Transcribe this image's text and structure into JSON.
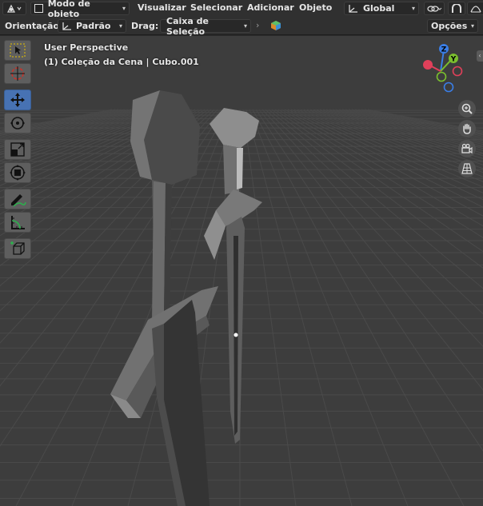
{
  "header": {
    "mode_label": "Modo de objeto",
    "menus": [
      "Visualizar",
      "Selecionar",
      "Adicionar",
      "Objeto"
    ],
    "transform_orientation": "Global"
  },
  "toolheader": {
    "orientation_label": "Orientação:",
    "orientation_value": "Padrão",
    "drag_label": "Drag:",
    "drag_value": "Caixa de Seleção",
    "options_label": "Opções"
  },
  "viewport": {
    "perspective_label": "User Perspective",
    "collection_label": "(1) Coleção da Cena | Cubo.001"
  },
  "gizmo": {
    "x": "X",
    "y": "Y",
    "z": "Z",
    "x_color": "#e0405a",
    "y_color": "#7bbf2e",
    "z_color": "#3a7ee6"
  },
  "toolbar": {
    "tools": [
      "tweak",
      "cursor",
      "move",
      "rotate",
      "scale",
      "transform",
      "annotate",
      "measure",
      "add-cube"
    ],
    "active": "move"
  },
  "colors": {
    "accent": "#4772b3",
    "viewport_bg": "#3d3d3d",
    "header_bg": "#303030"
  }
}
